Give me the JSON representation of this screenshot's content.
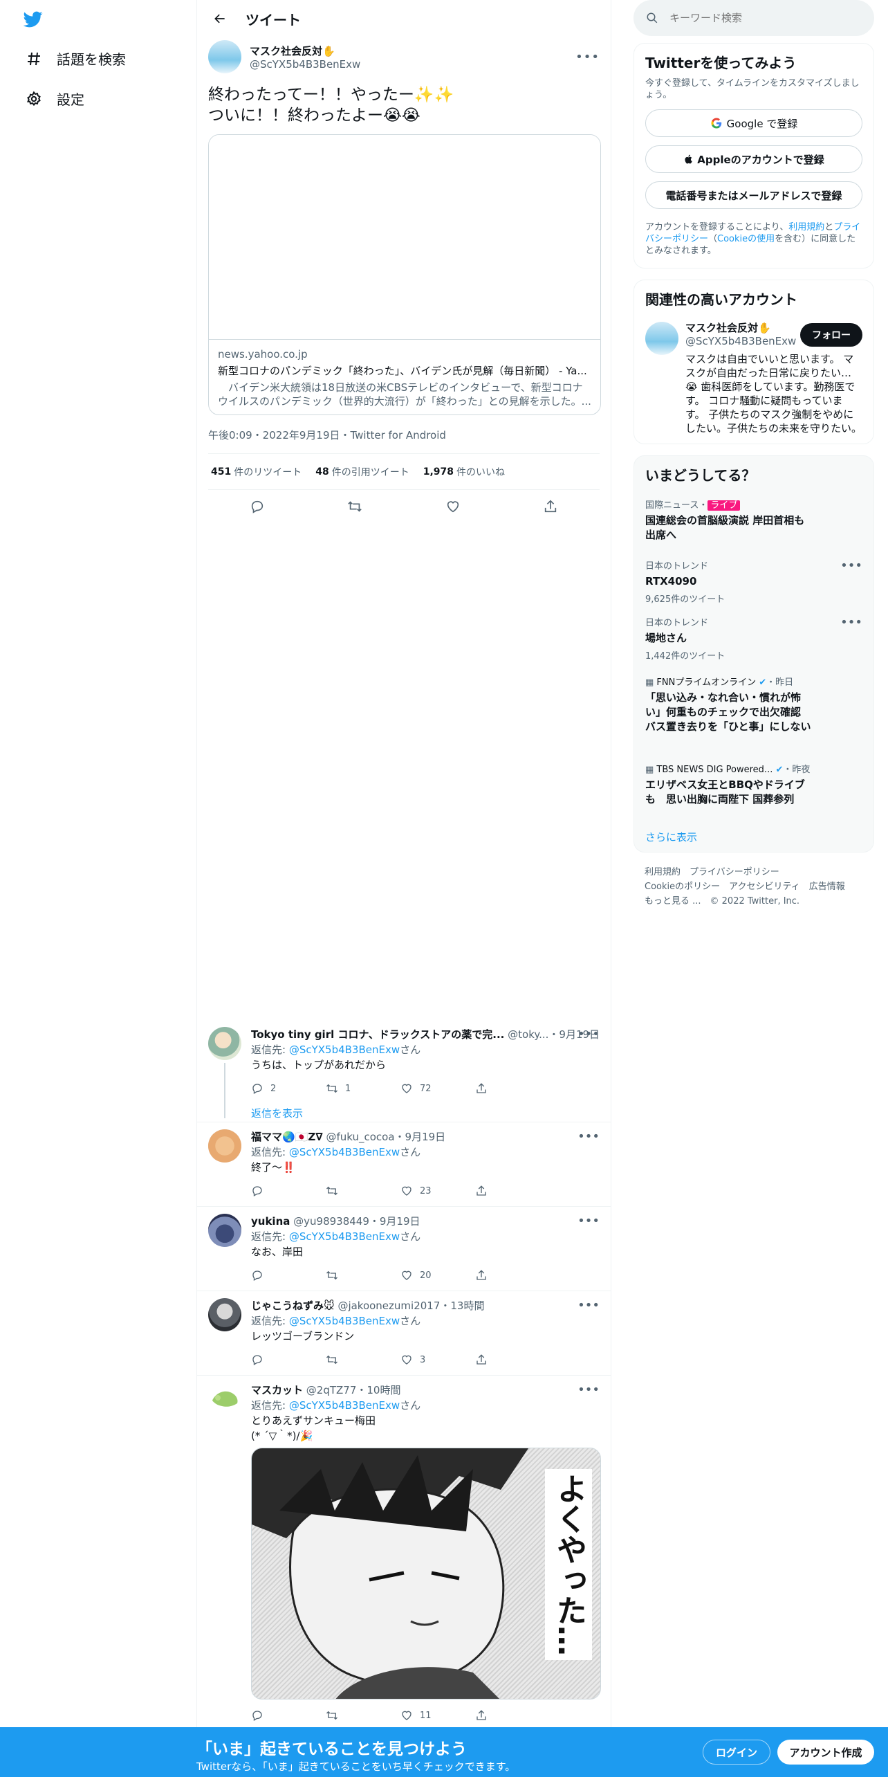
{
  "nav": {
    "explore": "話題を検索",
    "settings": "設定"
  },
  "header": {
    "title": "ツイート"
  },
  "tweet": {
    "name": "マスク社会反対✋",
    "handle": "@ScYX5b4B3BenExw",
    "text": "終わったってー！！やったー✨✨\nついに！！終わったよー😭😭",
    "card": {
      "domain": "news.yahoo.co.jp",
      "title": "新型コロナのパンデミック「終わった」、バイデン氏が見解（毎日新聞） - Ya...",
      "desc": "　バイデン米大統領は18日放送の米CBSテレビのインタビューで、新型コロナウイルスのパンデミック（世界的大流行）が「終わった」との見解を示した。..."
    },
    "meta": "午後0:09・2022年9月19日・Twitter for Android",
    "retweets": "451",
    "retweets_label": "件のリツイート",
    "quotes": "48",
    "quotes_label": "件の引用ツイート",
    "likes": "1,978",
    "likes_label": "件のいいね"
  },
  "replies": [
    {
      "name": "Tokyo tiny girl コロナ、ドラックストアの薬で完...",
      "handle": "@toky...",
      "time": "・9月19日",
      "reply_to_prefix": "返信先: ",
      "reply_to": "@ScYX5b4B3BenExw",
      "reply_to_suffix": "さん",
      "text": "うちは、トップがあれだから",
      "replies": "2",
      "retweets": "1",
      "likes": "72",
      "show_replies": "返信を表示"
    },
    {
      "name": "福ママ🌏🇯🇵Z∇",
      "handle": "@fuku_cocoa",
      "time": "・9月19日",
      "reply_to_prefix": "返信先: ",
      "reply_to": "@ScYX5b4B3BenExw",
      "reply_to_suffix": "さん",
      "text": "終了〜‼️",
      "replies": "",
      "retweets": "",
      "likes": "23"
    },
    {
      "name": "yukina",
      "handle": "@yu98938449",
      "time": "・9月19日",
      "reply_to_prefix": "返信先: ",
      "reply_to": "@ScYX5b4B3BenExw",
      "reply_to_suffix": "さん",
      "text": "なお、岸田",
      "replies": "",
      "retweets": "",
      "likes": "20"
    },
    {
      "name": "じゃこうねずみ🐭",
      "handle": "@jakoonezumi2017",
      "time": "・13時間",
      "reply_to_prefix": "返信先: ",
      "reply_to": "@ScYX5b4B3BenExw",
      "reply_to_suffix": "さん",
      "text": "レッツゴーブランドン",
      "replies": "",
      "retweets": "",
      "likes": "3"
    },
    {
      "name": "マスカット",
      "handle": "@2qTZ77",
      "time": "・10時間",
      "reply_to_prefix": "返信先: ",
      "reply_to": "@ScYX5b4B3BenExw",
      "reply_to_suffix": "さん",
      "text": "とりあえずサンキュー梅田",
      "text2": "(* ´▽｀*)/🎉",
      "image_caption": "よくやった…",
      "replies": "",
      "retweets": "",
      "likes": "11"
    }
  ],
  "right": {
    "search_placeholder": "キーワード検索",
    "signup": {
      "title": "Twitterを使ってみよう",
      "sub": "今すぐ登録して、タイムラインをカスタマイズしましょう。",
      "google": "Google で登録",
      "apple": "Appleのアカウントで登録",
      "phone": "電話番号またはメールアドレスで登録",
      "legal_1": "アカウントを登録することにより、",
      "legal_terms": "利用規約",
      "legal_2": "と",
      "legal_privacy": "プライバシーポリシー",
      "legal_3": "（",
      "legal_cookie": "Cookieの使用",
      "legal_4": "を含む）に同意したとみなされます。"
    },
    "related": {
      "title": "関連性の高いアカウント",
      "name": "マスク社会反対✋",
      "handle": "@ScYX5b4B3BenExw",
      "follow": "フォロー",
      "bio": "マスクは自由でいいと思います。 マスクが自由だった日常に戻りたい…😭 歯科医師をしています。勤務医です。 コロナ騒動に疑問もっています。 子供たちのマスク強制をやめにしたい。子供たちの未来を守りたい。"
    },
    "trends": {
      "title": "いまどうしてる？",
      "items": [
        {
          "cat": "国際ニュース・",
          "live": "ライブ",
          "name": "国連総会の首脳級演説 岸田首相も出席へ"
        },
        {
          "cat": "日本のトレンド",
          "name": "RTX4090",
          "count": "9,625件のツイート"
        },
        {
          "cat": "日本のトレンド",
          "name": "場地さん",
          "count": "1,442件のツイート"
        },
        {
          "cat": "FNNプライムオンライン",
          "time": "・昨日",
          "name": "「思い込み・なれ合い・慣れが怖い」何重ものチェックで出欠確認 バス置き去りを「ひと事」にしない"
        },
        {
          "cat": "TBS NEWS DIG Powered...",
          "time": "・昨夜",
          "name": "エリザベス女王とBBQやドライブも　思い出胸に両陛下 国葬参列"
        }
      ],
      "more": "さらに表示"
    },
    "footer": {
      "line1": "利用規約　プライバシーポリシー",
      "line2": "Cookieのポリシー　アクセシビリティ　広告情報",
      "line3": "もっと見る ...　© 2022 Twitter, Inc."
    }
  },
  "bottom": {
    "title": "「いま」起きていることを見つけよう",
    "sub": "Twitterなら、「いま」起きていることをいち早くチェックできます。",
    "login": "ログイン",
    "signup": "アカウント作成"
  },
  "colors": {
    "accent": "#1d9bf0",
    "live": "#f91880",
    "text": "#0f1419",
    "muted": "#536471"
  }
}
